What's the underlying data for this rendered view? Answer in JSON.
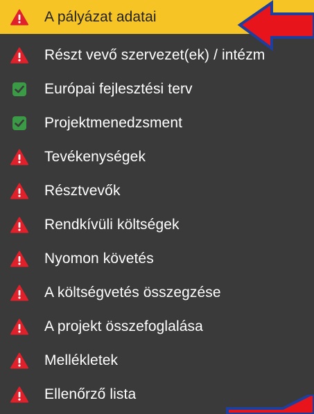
{
  "menu": {
    "items": [
      {
        "label": "A pályázat adatai",
        "status": "error",
        "icon": "warning-icon",
        "active": true
      },
      {
        "label": "Részt vevő szervezet(ek) / intézm",
        "status": "error",
        "icon": "warning-icon",
        "active": false
      },
      {
        "label": "Európai fejlesztési terv",
        "status": "complete",
        "icon": "checkbox-checked-icon",
        "active": false
      },
      {
        "label": "Projektmenedzsment",
        "status": "complete",
        "icon": "checkbox-checked-icon",
        "active": false
      },
      {
        "label": "Tevékenységek",
        "status": "error",
        "icon": "warning-icon",
        "active": false
      },
      {
        "label": "Résztvevők",
        "status": "error",
        "icon": "warning-icon",
        "active": false
      },
      {
        "label": "Rendkívüli költségek",
        "status": "error",
        "icon": "warning-icon",
        "active": false
      },
      {
        "label": "Nyomon követés",
        "status": "error",
        "icon": "warning-icon",
        "active": false
      },
      {
        "label": "A költségvetés összegzése",
        "status": "error",
        "icon": "warning-icon",
        "active": false
      },
      {
        "label": "A projekt összefoglalása",
        "status": "error",
        "icon": "warning-icon",
        "active": false
      },
      {
        "label": "Mellékletek",
        "status": "error",
        "icon": "warning-icon",
        "active": false
      },
      {
        "label": "Ellenőrző lista",
        "status": "error",
        "icon": "warning-icon",
        "active": false
      }
    ]
  },
  "colors": {
    "background": "#3a3a3a",
    "active_highlight": "#f7c425",
    "warning": "#e0202a",
    "complete": "#3a9a46",
    "annotation_arrow": "#e8141c",
    "annotation_outline": "#1f3f9c"
  }
}
